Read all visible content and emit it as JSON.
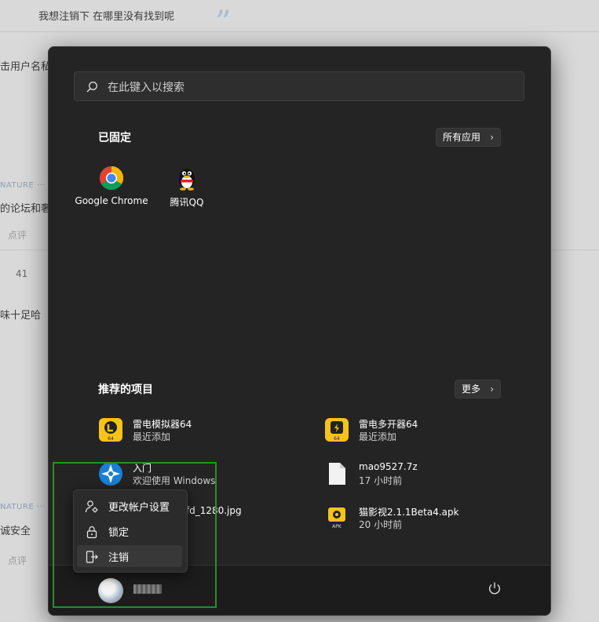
{
  "background": {
    "comment": "我想注销下  在哪里没有找到呢",
    "line1": "击用户名私",
    "meta1": "NATURE ···",
    "line2": "的论坛和奢",
    "action1": "点评",
    "count": "41",
    "line3": "味十足哈",
    "meta2": "NATURE ···",
    "line4": "诚安全",
    "action2": "点评"
  },
  "search": {
    "placeholder": "在此键入以搜索"
  },
  "pinned": {
    "title": "已固定",
    "all_apps": "所有应用",
    "apps": [
      {
        "label": "Google Chrome",
        "icon": "chrome-icon"
      },
      {
        "label": "腾讯QQ",
        "icon": "qq-icon"
      }
    ]
  },
  "recommended": {
    "title": "推荐的项目",
    "more": "更多",
    "items": [
      {
        "name": "雷电模拟器64",
        "sub": "最近添加",
        "icon": "ldplayer-icon"
      },
      {
        "name": "雷电多开器64",
        "sub": "最近添加",
        "icon": "ldmulti-icon"
      },
      {
        "name": "入门",
        "sub": "欢迎使用 Windows",
        "icon": "get-started-icon"
      },
      {
        "name": "mao9527.7z",
        "sub": "17 小时前",
        "icon": "file-icon"
      },
      {
        "name": "f7fd_1280.jpg",
        "sub": "",
        "icon": "image-file-icon"
      },
      {
        "name": "猫影视2.1.1Beta4.apk",
        "sub": "20 小时前",
        "icon": "apk-icon"
      }
    ]
  },
  "context_menu": {
    "items": [
      {
        "label": "更改帐户设置",
        "icon": "user-settings-icon"
      },
      {
        "label": "锁定",
        "icon": "lock-icon"
      },
      {
        "label": "注销",
        "icon": "sign-out-icon"
      }
    ]
  },
  "colors": {
    "highlight": "#2e8b2e",
    "menu_bg": "#242424"
  }
}
